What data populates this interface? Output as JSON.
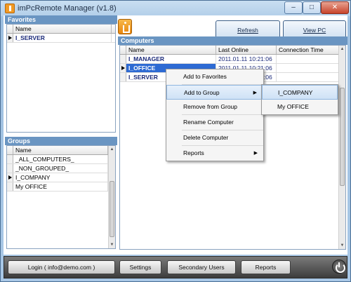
{
  "window": {
    "title": "imPcRemote Manager (v1.8)",
    "controls": {
      "min": "–",
      "max": "□",
      "close": "✕"
    }
  },
  "favorites": {
    "title": "Favorites",
    "column": "Name",
    "rows": [
      {
        "name": "I_SERVER"
      }
    ]
  },
  "groups": {
    "title": "Groups",
    "column": "Name",
    "rows": [
      {
        "name": "_ALL_COMPUTERS_"
      },
      {
        "name": "_NON_GROUPED_"
      },
      {
        "name": "I_COMPANY"
      },
      {
        "name": "My OFFICE"
      }
    ]
  },
  "computers": {
    "title": "Computers",
    "columns": {
      "name": "Name",
      "last_online": "Last Online",
      "connection_time": "Connection Time"
    },
    "rows": [
      {
        "name": "I_MANAGER",
        "last_online": "2011.01.11 10:21:06"
      },
      {
        "name": "I_OFFICE",
        "last_online": "2011.01.11 10:21:06"
      },
      {
        "name": "I_SERVER",
        "last_online": "2011.01.11 10:21:06"
      }
    ]
  },
  "toolbar": {
    "refresh": "Refresh",
    "view_pc": "View PC"
  },
  "context_menu": {
    "items": [
      "Add to Favorites",
      "Add to Group",
      "Remove from Group",
      "Rename Computer",
      "Delete Computer",
      "Reports"
    ],
    "submenu": [
      "I_COMPANY",
      "My OFFICE"
    ]
  },
  "bottom": {
    "login": "Login ( info@demo.com )",
    "settings": "Settings",
    "secondary_users": "Secondary Users",
    "reports": "Reports"
  },
  "colors": {
    "selection": "#2d6ad3",
    "panel_header": "#6a95c2"
  }
}
